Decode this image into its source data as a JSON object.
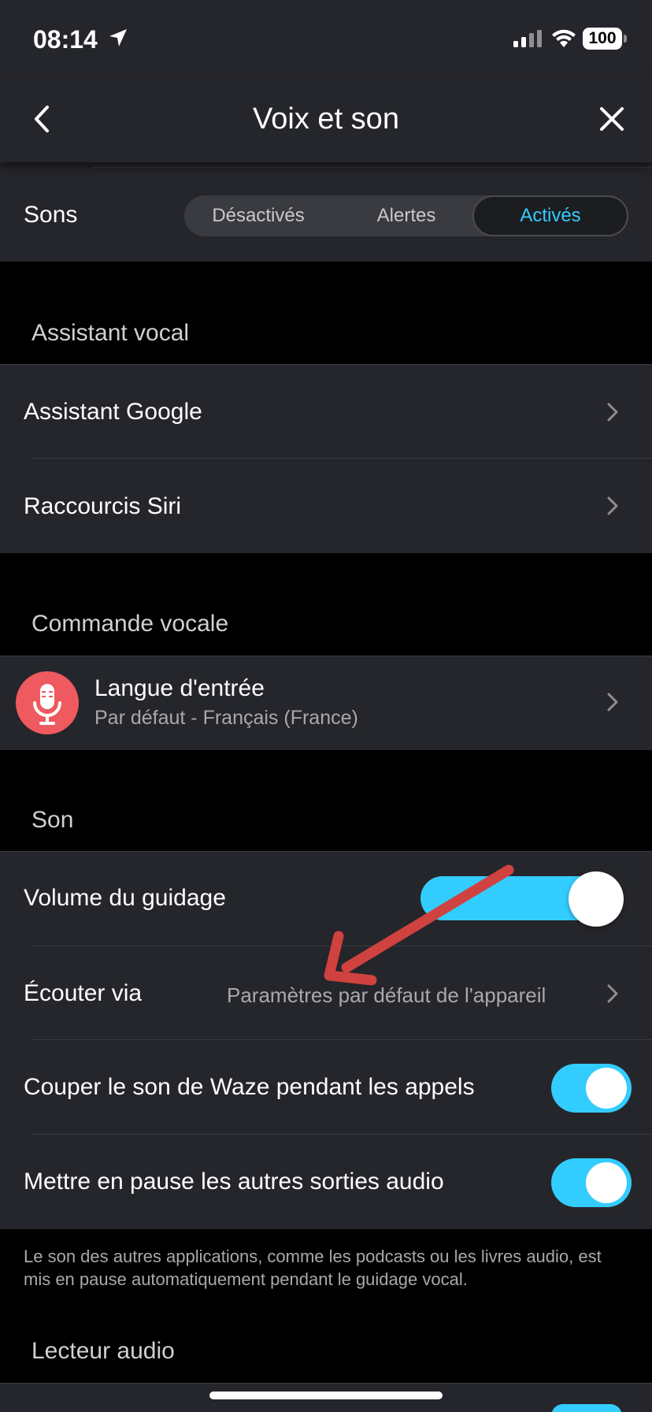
{
  "status_bar": {
    "time": "08:14",
    "battery": "100"
  },
  "header": {
    "title": "Voix et son"
  },
  "sons": {
    "label": "Sons",
    "options": [
      "Désactivés",
      "Alertes",
      "Activés"
    ],
    "selected": "Activés"
  },
  "assistant_vocal": {
    "heading": "Assistant vocal",
    "items": [
      "Assistant Google",
      "Raccourcis Siri"
    ]
  },
  "commande_vocale": {
    "heading": "Commande vocale",
    "langue_title": "Langue d'entrée",
    "langue_value": "Par défaut - Français (France)"
  },
  "son": {
    "heading": "Son",
    "volume_label": "Volume du guidage",
    "volume_level": 0.85,
    "ecouter_label": "Écouter via",
    "ecouter_value": "Paramètres par défaut de l'appareil",
    "couper_label": "Couper le son de Waze pendant les appels",
    "couper_on": true,
    "pause_label": "Mettre en pause les autres sorties audio",
    "pause_on": true,
    "footnote": "Le son des autres applications, comme les podcasts ou les livres audio, est mis en pause automatiquement pendant le guidage vocal."
  },
  "lecteur_audio": {
    "heading": "Lecteur audio"
  },
  "colors": {
    "accent": "#33ccff",
    "mic": "#ee5a5f",
    "annotation_arrow": "#d0423f",
    "surface": "#25262b"
  }
}
